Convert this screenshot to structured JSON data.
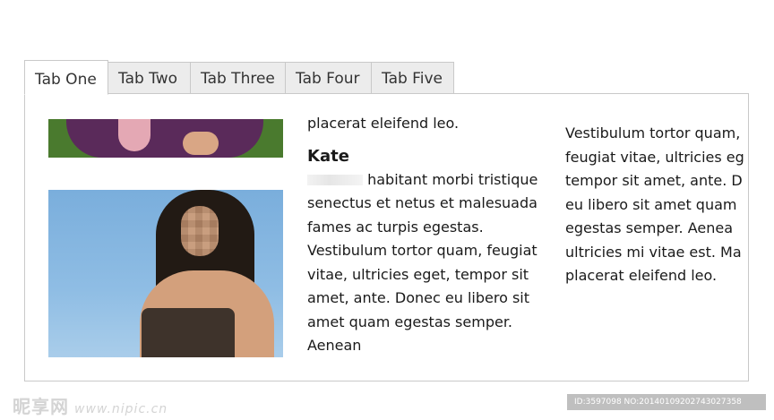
{
  "tabs": [
    "Tab One",
    "Tab Two",
    "Tab Three",
    "Tab Four",
    "Tab Five"
  ],
  "active_tab": "Tab One",
  "middle_column": {
    "lead": "placerat eleifend leo.",
    "heading": "Kate",
    "body": "habitant morbi tristique senectus et netus et malesuada fames ac turpis egestas. Vestibulum tortor quam, feugiat vitae, ultricies eget, tempor sit amet, ante. Donec eu libero sit amet quam egestas semper. Aenean"
  },
  "right_column": {
    "lines": [
      "Vestibulum tortor quam,",
      "feugiat vitae, ultricies eg",
      "tempor sit amet, ante. D",
      "eu libero sit amet quam",
      "egestas semper. Aenea",
      "ultricies mi vitae est. Ma",
      "placerat eleifend leo."
    ]
  },
  "watermark": {
    "left_text": "昵享网",
    "left_url": "www.nipic.cn",
    "right_text": "ID:3597098 NO:20140109202743027358"
  }
}
